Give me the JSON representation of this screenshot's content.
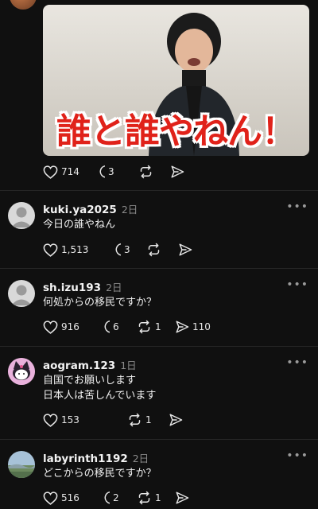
{
  "top_post": {
    "image_caption": "誰と誰やねん！",
    "actions": {
      "likes": "714",
      "replies": "3",
      "reposts": "",
      "shares": ""
    }
  },
  "posts": [
    {
      "username": "kuki.ya2025",
      "time": "2日",
      "lines": [
        "今日の誰やねん"
      ],
      "actions": {
        "likes": "1,513",
        "replies": "3",
        "reposts": "",
        "shares": ""
      }
    },
    {
      "username": "sh.izu193",
      "time": "2日",
      "lines": [
        "何処からの移民ですか？"
      ],
      "actions": {
        "likes": "916",
        "replies": "6",
        "reposts": "1",
        "shares": "110"
      }
    },
    {
      "username": "aogram.123",
      "time": "1日",
      "lines": [
        "自国でお願いします",
        "日本人は苦しんでいます"
      ],
      "actions": {
        "likes": "153",
        "replies": "",
        "reposts": "1",
        "shares": ""
      }
    },
    {
      "username": "labyrinth1192",
      "time": "2日",
      "lines": [
        "どこからの移民ですか？"
      ],
      "actions": {
        "likes": "516",
        "replies": "2",
        "reposts": "1",
        "shares": ""
      }
    }
  ],
  "more_label": "•••"
}
